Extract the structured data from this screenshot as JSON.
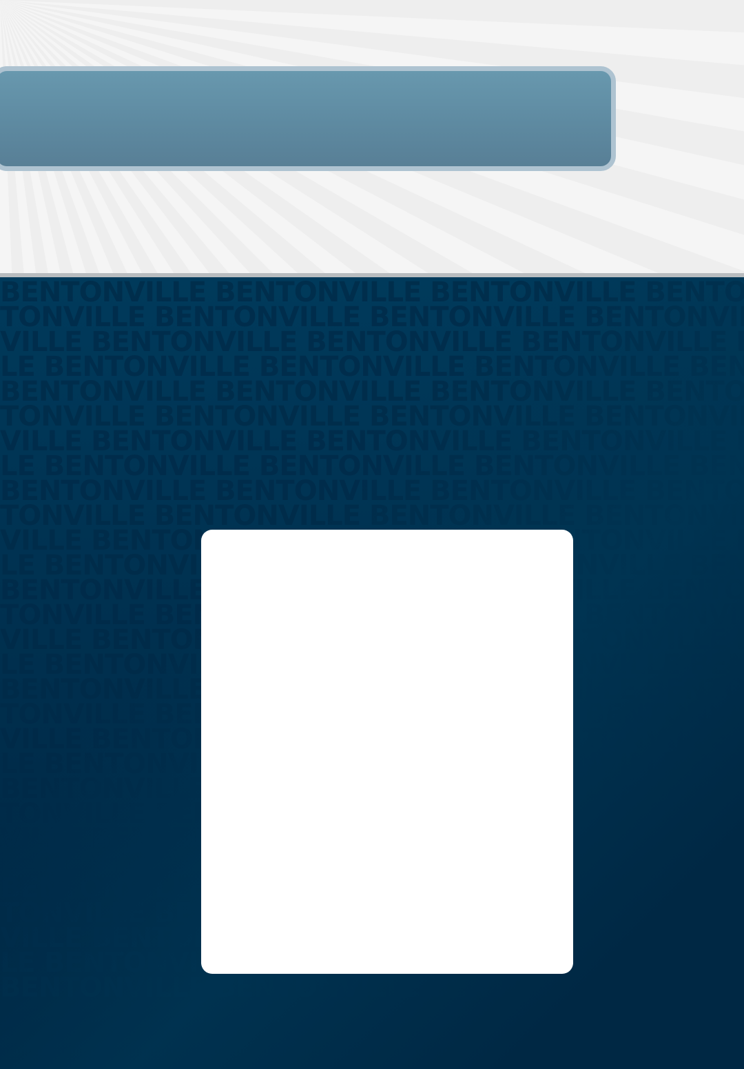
{
  "background_pattern": {
    "word": "BENTONVILLE",
    "rows": 29
  },
  "colors": {
    "top_background": "#f5f5f5",
    "banner": "#6898ae",
    "banner_border": "#aec3d1",
    "divider": "#b8bcbf",
    "bottom_background": "#003a5b",
    "pattern_text": "#002a48",
    "card": "#ffffff"
  }
}
